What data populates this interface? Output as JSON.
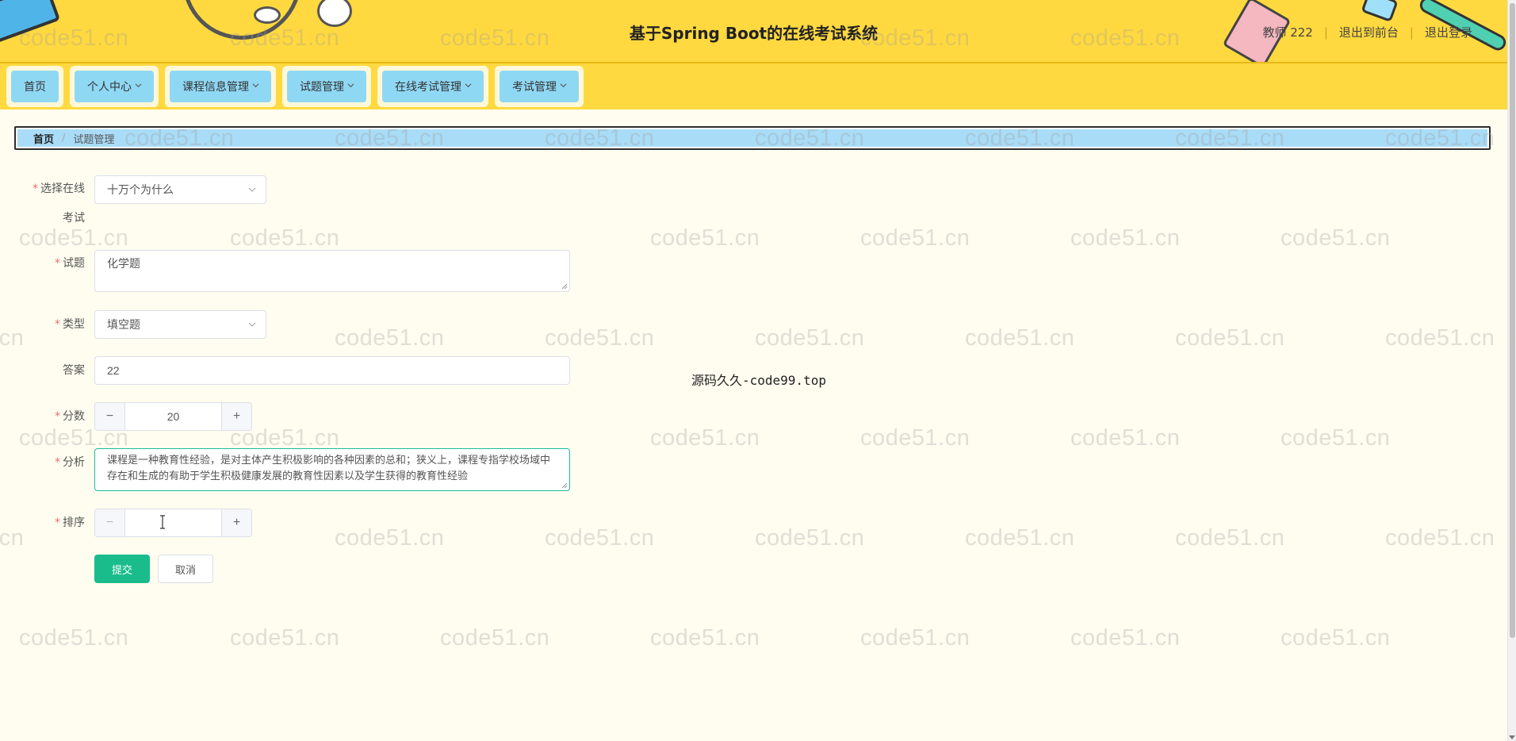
{
  "header": {
    "title": "基于Spring Boot的在线考试系统",
    "user_label": "教师 222",
    "front_link": "退出到前台",
    "logout_link": "退出登录"
  },
  "nav": {
    "items": [
      {
        "label": "首页",
        "has_dropdown": false
      },
      {
        "label": "个人中心",
        "has_dropdown": true
      },
      {
        "label": "课程信息管理",
        "has_dropdown": true
      },
      {
        "label": "试题管理",
        "has_dropdown": true
      },
      {
        "label": "在线考试管理",
        "has_dropdown": true
      },
      {
        "label": "考试管理",
        "has_dropdown": true
      }
    ]
  },
  "breadcrumb": {
    "home": "首页",
    "separator": "/",
    "current": "试题管理"
  },
  "form": {
    "exam": {
      "label_line1": "选择在线",
      "label_line2": "考试",
      "value": "十万个为什么"
    },
    "question": {
      "label": "试题",
      "value": "化学题"
    },
    "type": {
      "label": "类型",
      "value": "填空题"
    },
    "answer": {
      "label": "答案",
      "value": "22"
    },
    "score": {
      "label": "分数",
      "value": "20",
      "minus": "−",
      "plus": "+"
    },
    "analysis": {
      "label": "分析",
      "value": "课程是一种教育性经验，是对主体产生积极影响的各种因素的总和；狭义上，课程专指学校场域中存在和生成的有助于学生积极健康发展的教育性因素以及学生获得的教育性经验"
    },
    "order": {
      "label": "排序",
      "value": "",
      "minus": "−",
      "plus": "+"
    },
    "submit_label": "提交",
    "cancel_label": "取消"
  },
  "center_note": "源码久久-code99.top",
  "watermark": "code51.cn",
  "colors": {
    "header_bg": "#ffd93f",
    "nav_item_bg": "#8fd8f4",
    "breadcrumb_bg": "#a9dcf7",
    "page_bg": "#fffdf0",
    "primary": "#1abc8c",
    "required": "#f56c6c"
  }
}
